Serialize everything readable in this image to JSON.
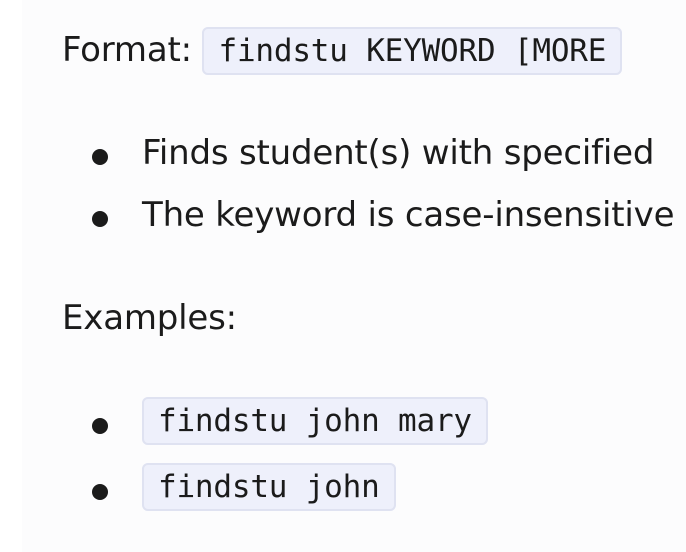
{
  "format": {
    "label": "Format:",
    "code": "findstu KEYWORD [MORE"
  },
  "bullets": [
    "Finds student(s) with specified",
    "The keyword is case-insensitive"
  ],
  "examples": {
    "label": "Examples:",
    "items": [
      "findstu john mary",
      "findstu john"
    ]
  }
}
